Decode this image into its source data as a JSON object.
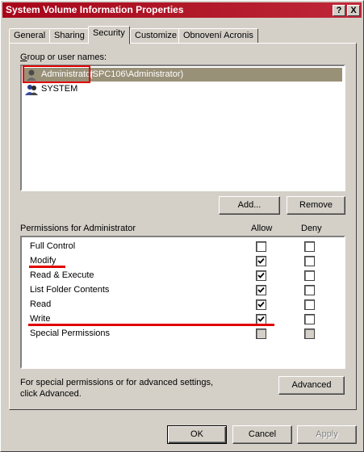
{
  "window": {
    "title": "System Volume Information Properties"
  },
  "title_buttons": {
    "help": "?",
    "close": "X"
  },
  "tabs": [
    {
      "label": "General"
    },
    {
      "label": "Sharing"
    },
    {
      "label": "Security"
    },
    {
      "label": "Customize"
    },
    {
      "label": "Obnovení Acronis"
    }
  ],
  "groups": {
    "label": "Group or user names:",
    "users": [
      {
        "name": "Administrator",
        "detail": " (SPC106\\Administrator)",
        "selected": true
      },
      {
        "name": "SYSTEM",
        "detail": "",
        "selected": false
      }
    ],
    "add_label": "Add...",
    "remove_label": "Remove"
  },
  "permissions": {
    "label": "Permissions for Administrator",
    "allow_header": "Allow",
    "deny_header": "Deny",
    "rows": [
      {
        "name": "Full Control",
        "allow": false,
        "deny": false
      },
      {
        "name": "Modify",
        "allow": true,
        "deny": false
      },
      {
        "name": "Read & Execute",
        "allow": true,
        "deny": false
      },
      {
        "name": "List Folder Contents",
        "allow": true,
        "deny": false
      },
      {
        "name": "Read",
        "allow": true,
        "deny": false
      },
      {
        "name": "Write",
        "allow": true,
        "deny": false
      },
      {
        "name": "Special Permissions",
        "allow": false,
        "deny": false
      }
    ]
  },
  "advanced": {
    "text_line1": "For special permissions or for advanced settings,",
    "text_line2": "click Advanced.",
    "button_label": "Advanced"
  },
  "footer": {
    "ok_label": "OK",
    "cancel_label": "Cancel",
    "apply_label": "Apply"
  },
  "colors": {
    "title_bar": "#a8051a",
    "selection": "#999078",
    "annotation": "#e00000"
  }
}
